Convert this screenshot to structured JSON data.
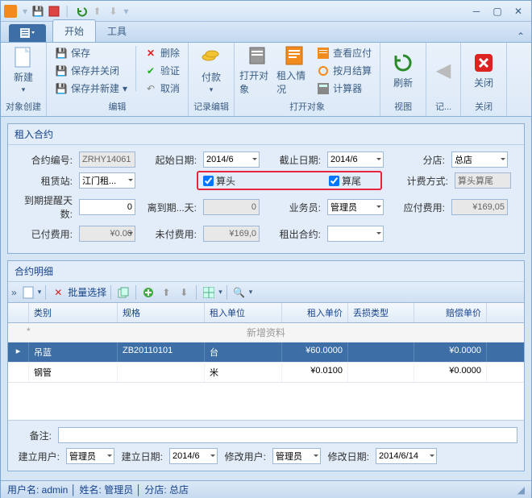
{
  "tabs": {
    "start": "开始",
    "tools": "工具"
  },
  "ribbon": {
    "group1": {
      "label": "对象创建",
      "new": "新建"
    },
    "group2": {
      "label": "编辑",
      "save": "保存",
      "saveClose": "保存并关闭",
      "saveNew": "保存并新建",
      "delete": "删除",
      "verify": "验证",
      "cancel": "取消"
    },
    "group3": {
      "label": "记录编辑",
      "pay": "付款"
    },
    "group4": {
      "label": "打开对象",
      "openObj": "打开对象",
      "rentStatus": "租入情况",
      "viewPay": "查看应付",
      "monthly": "按月结算",
      "calc": "计算器"
    },
    "group5": {
      "label": "视图",
      "refresh": "刷新"
    },
    "group6": {
      "label": "记...",
      "prev": ""
    },
    "group7": {
      "label": "关闭",
      "close": "关闭"
    }
  },
  "panel1": {
    "title": "租入合约",
    "contractNo": {
      "label": "合约编号:",
      "value": "ZRHY14061"
    },
    "startDate": {
      "label": "起始日期:",
      "value": "2014/6"
    },
    "endDate": {
      "label": "截止日期:",
      "value": "2014/6"
    },
    "branch": {
      "label": "分店:",
      "value": "总店"
    },
    "station": {
      "label": "租赁站:",
      "value": "江门租..."
    },
    "calcHead": "算头",
    "calcTail": "算尾",
    "billMethod": {
      "label": "计费方式:",
      "value": "算头算尾"
    },
    "remindDays": {
      "label": "到期提醒天数:",
      "value": "0"
    },
    "daysToExpire": {
      "label": "离到期...天:",
      "value": "0"
    },
    "clerk": {
      "label": "业务员:",
      "value": "管理员"
    },
    "payable": {
      "label": "应付费用:",
      "value": "¥169,05"
    },
    "paid": {
      "label": "已付费用:",
      "value": "¥0.00"
    },
    "unpaid": {
      "label": "未付费用:",
      "value": "¥169,0"
    },
    "rentContract": {
      "label": "租出合约:"
    }
  },
  "panel2": {
    "title": "合约明细",
    "batchSelect": "批量选择",
    "cols": {
      "cat": "类别",
      "spec": "规格",
      "unit": "租入单位",
      "price": "租入单价",
      "lossType": "丢损类型",
      "compPrice": "赔偿单价"
    },
    "newRow": "新增资料",
    "rows": [
      {
        "cat": "吊蓝",
        "spec": "ZB20110101",
        "unit": "台",
        "price": "¥60.0000",
        "lossType": "",
        "compPrice": "¥0.0000"
      },
      {
        "cat": "钢管",
        "spec": "",
        "unit": "米",
        "price": "¥0.0100",
        "lossType": "",
        "compPrice": "¥0.0000"
      }
    ]
  },
  "footer": {
    "remark": {
      "label": "备注:"
    },
    "createUser": {
      "label": "建立用户:",
      "value": "管理员"
    },
    "createDate": {
      "label": "建立日期:",
      "value": "2014/6"
    },
    "modUser": {
      "label": "修改用户:",
      "value": "管理员"
    },
    "modDate": {
      "label": "修改日期:",
      "value": "2014/6/14"
    }
  },
  "status": "用户名: admin │ 姓名: 管理员 │ 分店: 总店"
}
